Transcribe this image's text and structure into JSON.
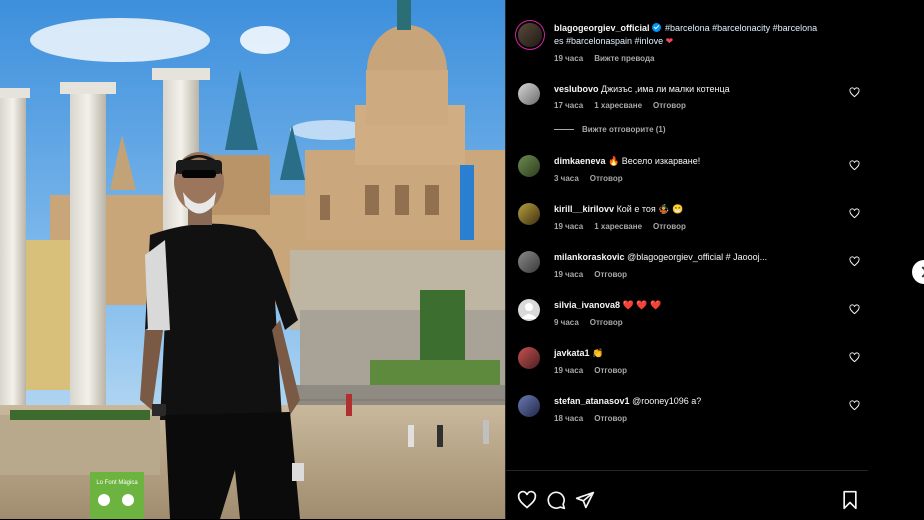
{
  "post": {
    "author": "blagogeorgiev_official",
    "caption_line1": "#barcelona #barcelonacity #barcelona",
    "caption_line2": "es #barcelonaspain #inlove",
    "time": "19 часа",
    "see_translation": "Вижте превода"
  },
  "photo": {
    "sign_text": "Lo Font Màgica",
    "description_icons": [
      "person-photo",
      "museum-building",
      "columns"
    ]
  },
  "comments": [
    {
      "user": "veslubovo",
      "text": "Джизъс ,има ли малки котенца",
      "time": "17 часа",
      "likes": "1 харесване",
      "reply": "Отговор"
    },
    {
      "user": "dimkaeneva",
      "text": "🔥 Весело изкарване!",
      "time": "3 часа",
      "reply": "Отговор"
    },
    {
      "user": "kirill__kirilovv",
      "text": "Кой е тоя 🤹 😁",
      "time": "19 часа",
      "likes": "1 харесване",
      "reply": "Отговор"
    },
    {
      "user": "milankoraskovic",
      "text": "@blagogeorgiev_official # Jaoooj...",
      "time": "19 часа",
      "reply": "Отговор"
    },
    {
      "user": "silvia_ivanova8",
      "text": "❤️ ❤️ ❤️",
      "time": "9 часа",
      "reply": "Отговор"
    },
    {
      "user": "javkata1",
      "text": "👏",
      "time": "19 часа",
      "reply": "Отговор"
    },
    {
      "user": "stefan_atanasov1",
      "text": "@rooney1096 а?",
      "time": "18 часа",
      "reply": "Отговор"
    }
  ],
  "view_replies": "Вижте отговорите (1)",
  "icons": {
    "like": "heart-icon",
    "comment": "comment-icon",
    "share": "send-icon",
    "save": "bookmark-icon",
    "next": "chevron-right-icon"
  },
  "colors": {
    "background": "#000000",
    "text": "#f5f5f5",
    "muted": "#a8a8a8",
    "verified": "#0095f6",
    "heart_emoji": "#ed4956"
  }
}
